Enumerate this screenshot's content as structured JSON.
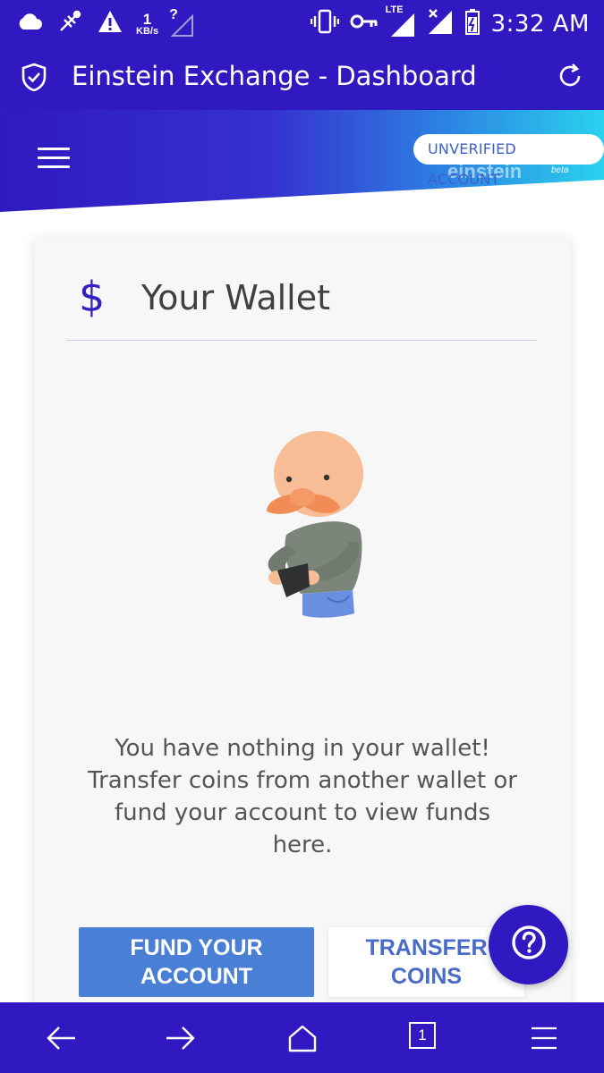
{
  "status_bar": {
    "speed_value": "1",
    "speed_unit": "KB/s",
    "signal_unknown": "?",
    "network_type": "LTE",
    "time": "3:32 AM"
  },
  "app_bar": {
    "title": "Einstein Exchange - Dashboard"
  },
  "header": {
    "account_status": "UNVERIFIED ACCOUNT",
    "logo_text": "einstein",
    "logo_badge": "beta"
  },
  "wallet": {
    "currency_symbol": "$",
    "title": "Your Wallet",
    "empty_message": "You have nothing in your wallet! Transfer coins from another wallet or fund your account to view funds here.",
    "fund_button_line1": "FUND YOUR",
    "fund_button_line2": "ACCOUNT",
    "transfer_button_line1": "TRANSFER",
    "transfer_button_line2": "COINS"
  },
  "help_button": {
    "icon": "help-icon"
  },
  "bottom_nav": {
    "tab_count": "1",
    "items": [
      "back-icon",
      "forward-icon",
      "home-icon",
      "tabs-icon",
      "menu-icon"
    ]
  },
  "colors": {
    "primary": "#3019c0",
    "accent_blue": "#4a7fd6",
    "banner_cyan": "#2ad2ee"
  }
}
